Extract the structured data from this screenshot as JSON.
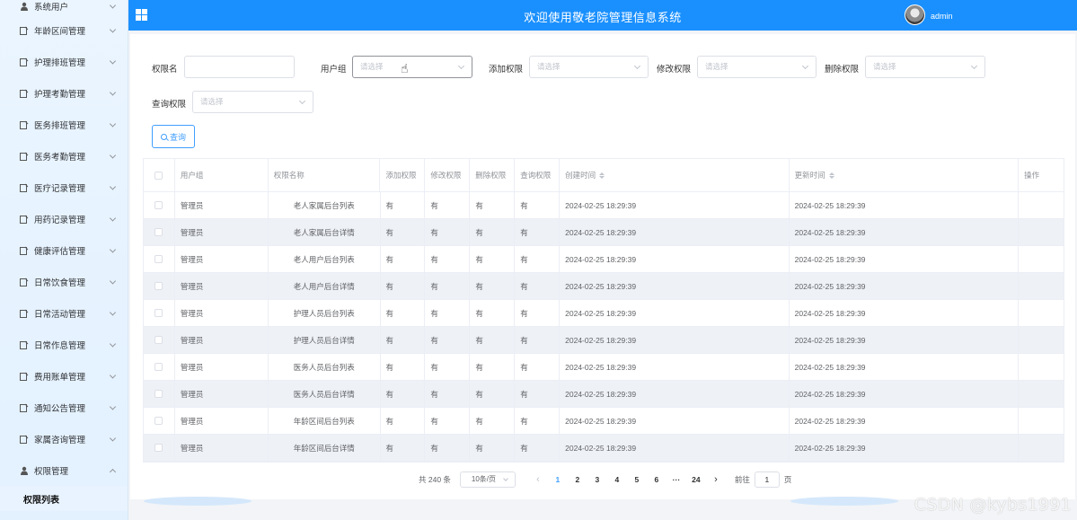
{
  "header": {
    "title": "欢迎使用敬老院管理信息系统",
    "username": "admin"
  },
  "sidebar": {
    "items": [
      {
        "label": "系统用户",
        "icon": "user-icon"
      },
      {
        "label": "年龄区间管理",
        "icon": "edit-icon"
      },
      {
        "label": "护理排班管理",
        "icon": "edit-icon"
      },
      {
        "label": "护理考勤管理",
        "icon": "edit-icon"
      },
      {
        "label": "医务排班管理",
        "icon": "edit-icon"
      },
      {
        "label": "医务考勤管理",
        "icon": "edit-icon"
      },
      {
        "label": "医疗记录管理",
        "icon": "edit-icon"
      },
      {
        "label": "用药记录管理",
        "icon": "edit-icon"
      },
      {
        "label": "健康评估管理",
        "icon": "edit-icon"
      },
      {
        "label": "日常饮食管理",
        "icon": "edit-icon"
      },
      {
        "label": "日常活动管理",
        "icon": "edit-icon"
      },
      {
        "label": "日常作息管理",
        "icon": "edit-icon"
      },
      {
        "label": "费用账单管理",
        "icon": "edit-icon"
      },
      {
        "label": "通知公告管理",
        "icon": "edit-icon"
      },
      {
        "label": "家属咨询管理",
        "icon": "edit-icon"
      },
      {
        "label": "权限管理",
        "icon": "user-icon"
      }
    ],
    "active_sub": "权限列表"
  },
  "filters": {
    "name_label": "权限名",
    "group_label": "用户组",
    "add_label": "添加权限",
    "edit_label": "修改权限",
    "delete_label": "删除权限",
    "query_label": "查询权限",
    "placeholder": "请选择",
    "search_button": "查询"
  },
  "table": {
    "columns": [
      "用户组",
      "权限名称",
      "添加权限",
      "修改权限",
      "删除权限",
      "查询权限",
      "创建时间",
      "更新时间",
      "操作"
    ],
    "rows": [
      {
        "group": "管理员",
        "name": "老人家属后台列表",
        "add": "有",
        "edit": "有",
        "del": "有",
        "query": "有",
        "created": "2024-02-25 18:29:39",
        "updated": "2024-02-25 18:29:39"
      },
      {
        "group": "管理员",
        "name": "老人家属后台详情",
        "add": "有",
        "edit": "有",
        "del": "有",
        "query": "有",
        "created": "2024-02-25 18:29:39",
        "updated": "2024-02-25 18:29:39"
      },
      {
        "group": "管理员",
        "name": "老人用户后台列表",
        "add": "有",
        "edit": "有",
        "del": "有",
        "query": "有",
        "created": "2024-02-25 18:29:39",
        "updated": "2024-02-25 18:29:39"
      },
      {
        "group": "管理员",
        "name": "老人用户后台详情",
        "add": "有",
        "edit": "有",
        "del": "有",
        "query": "有",
        "created": "2024-02-25 18:29:39",
        "updated": "2024-02-25 18:29:39"
      },
      {
        "group": "管理员",
        "name": "护理人员后台列表",
        "add": "有",
        "edit": "有",
        "del": "有",
        "query": "有",
        "created": "2024-02-25 18:29:39",
        "updated": "2024-02-25 18:29:39"
      },
      {
        "group": "管理员",
        "name": "护理人员后台详情",
        "add": "有",
        "edit": "有",
        "del": "有",
        "query": "有",
        "created": "2024-02-25 18:29:39",
        "updated": "2024-02-25 18:29:39"
      },
      {
        "group": "管理员",
        "name": "医务人员后台列表",
        "add": "有",
        "edit": "有",
        "del": "有",
        "query": "有",
        "created": "2024-02-25 18:29:39",
        "updated": "2024-02-25 18:29:39"
      },
      {
        "group": "管理员",
        "name": "医务人员后台详情",
        "add": "有",
        "edit": "有",
        "del": "有",
        "query": "有",
        "created": "2024-02-25 18:29:39",
        "updated": "2024-02-25 18:29:39"
      },
      {
        "group": "管理员",
        "name": "年龄区间后台列表",
        "add": "有",
        "edit": "有",
        "del": "有",
        "query": "有",
        "created": "2024-02-25 18:29:39",
        "updated": "2024-02-25 18:29:39"
      },
      {
        "group": "管理员",
        "name": "年龄区间后台详情",
        "add": "有",
        "edit": "有",
        "del": "有",
        "query": "有",
        "created": "2024-02-25 18:29:39",
        "updated": "2024-02-25 18:29:39"
      }
    ]
  },
  "pagination": {
    "total": "共 240 条",
    "page_size": "10条/页",
    "pages": [
      "1",
      "2",
      "3",
      "4",
      "5",
      "6",
      "···",
      "24"
    ],
    "current": "1",
    "goto_label": "前往",
    "goto_value": "1",
    "page_unit": "页"
  },
  "watermark": "CSDN @kybs1991",
  "colors": {
    "header": "#1a90ff",
    "accent": "#409eff",
    "sidebar_bg": "#e3f1ff"
  }
}
